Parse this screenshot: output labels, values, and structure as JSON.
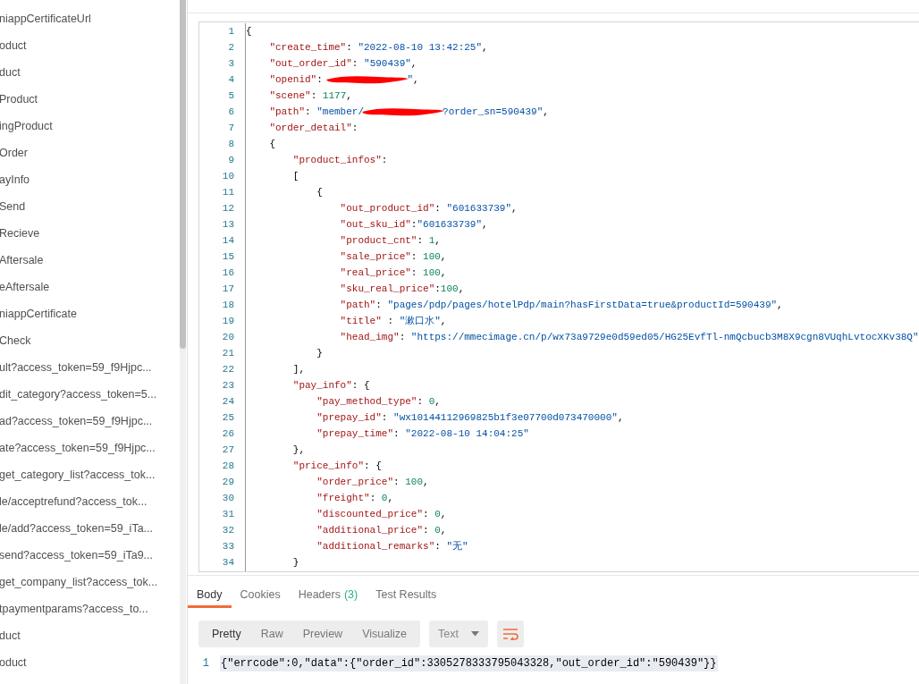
{
  "sidebar": {
    "items": [
      {
        "label": "niappCertificateUrl"
      },
      {
        "label": "oduct"
      },
      {
        "label": "duct"
      },
      {
        "label": "Product"
      },
      {
        "label": "ingProduct"
      },
      {
        "label": "Order"
      },
      {
        "label": "ayInfo"
      },
      {
        "label": "Send"
      },
      {
        "label": "Recieve"
      },
      {
        "label": "Aftersale"
      },
      {
        "label": "eAftersale"
      },
      {
        "label": "niappCertificate"
      },
      {
        "label": "Check"
      },
      {
        "label": "ult?access_token=59_f9Hjpc..."
      },
      {
        "label": "dit_category?access_token=5..."
      },
      {
        "label": "ad?access_token=59_f9Hjpc..."
      },
      {
        "label": "ate?access_token=59_f9Hjpc..."
      },
      {
        "label": "get_category_list?access_tok..."
      },
      {
        "label": "le/acceptrefund?access_tok..."
      },
      {
        "label": "le/add?access_token=59_iTa..."
      },
      {
        "label": "send?access_token=59_iTa9..."
      },
      {
        "label": "get_company_list?access_tok..."
      },
      {
        "label": "tpaymentparams?access_to..."
      },
      {
        "label": "duct"
      },
      {
        "label": "oduct"
      }
    ]
  },
  "editor": {
    "lines": [
      {
        "number": "1",
        "segments": [
          {
            "kind": "punct",
            "text": "{"
          }
        ]
      },
      {
        "number": "2",
        "segments": [
          {
            "kind": "key",
            "text": "    \"create_time\""
          },
          {
            "kind": "punct",
            "text": ": "
          },
          {
            "kind": "string",
            "text": "\"2022-08-10 13:42:25\""
          },
          {
            "kind": "punct",
            "text": ","
          }
        ]
      },
      {
        "number": "3",
        "segments": [
          {
            "kind": "key",
            "text": "    \"out_order_id\""
          },
          {
            "kind": "punct",
            "text": ": "
          },
          {
            "kind": "string",
            "text": "\"590439\""
          },
          {
            "kind": "punct",
            "text": ","
          }
        ]
      },
      {
        "number": "4",
        "segments": [
          {
            "kind": "key",
            "text": "    \"openid\""
          },
          {
            "kind": "punct",
            "text": ": "
          },
          {
            "kind": "redacted"
          },
          {
            "kind": "string",
            "text": "\""
          },
          {
            "kind": "punct",
            "text": ","
          }
        ]
      },
      {
        "number": "5",
        "segments": [
          {
            "kind": "key",
            "text": "    \"scene\""
          },
          {
            "kind": "punct",
            "text": ": "
          },
          {
            "kind": "number",
            "text": "1177"
          },
          {
            "kind": "punct",
            "text": ","
          }
        ]
      },
      {
        "number": "6",
        "segments": [
          {
            "kind": "key",
            "text": "    \"path\""
          },
          {
            "kind": "punct",
            "text": ": "
          },
          {
            "kind": "string",
            "text": "\"member/"
          },
          {
            "kind": "redacted"
          },
          {
            "kind": "string",
            "text": "?order_sn=590439\""
          },
          {
            "kind": "punct",
            "text": ","
          }
        ]
      },
      {
        "number": "7",
        "segments": [
          {
            "kind": "key",
            "text": "    \"order_detail\""
          },
          {
            "kind": "punct",
            "text": ":"
          }
        ]
      },
      {
        "number": "8",
        "segments": [
          {
            "kind": "punct",
            "text": "    {"
          }
        ]
      },
      {
        "number": "9",
        "segments": [
          {
            "kind": "key",
            "text": "        \"product_infos\""
          },
          {
            "kind": "punct",
            "text": ":"
          }
        ]
      },
      {
        "number": "10",
        "segments": [
          {
            "kind": "punct",
            "text": "        ["
          }
        ]
      },
      {
        "number": "11",
        "segments": [
          {
            "kind": "punct",
            "text": "            {"
          }
        ]
      },
      {
        "number": "12",
        "segments": [
          {
            "kind": "key",
            "text": "                \"out_product_id\""
          },
          {
            "kind": "punct",
            "text": ": "
          },
          {
            "kind": "string",
            "text": "\"601633739\""
          },
          {
            "kind": "punct",
            "text": ","
          }
        ]
      },
      {
        "number": "13",
        "segments": [
          {
            "kind": "key",
            "text": "                \"out_sku_id\""
          },
          {
            "kind": "punct",
            "text": ":"
          },
          {
            "kind": "string",
            "text": "\"601633739\""
          },
          {
            "kind": "punct",
            "text": ","
          }
        ]
      },
      {
        "number": "14",
        "segments": [
          {
            "kind": "key",
            "text": "                \"product_cnt\""
          },
          {
            "kind": "punct",
            "text": ": "
          },
          {
            "kind": "number",
            "text": "1"
          },
          {
            "kind": "punct",
            "text": ","
          }
        ]
      },
      {
        "number": "15",
        "segments": [
          {
            "kind": "key",
            "text": "                \"sale_price\""
          },
          {
            "kind": "punct",
            "text": ": "
          },
          {
            "kind": "number",
            "text": "100"
          },
          {
            "kind": "punct",
            "text": ","
          }
        ]
      },
      {
        "number": "16",
        "segments": [
          {
            "kind": "key",
            "text": "                \"real_price\""
          },
          {
            "kind": "punct",
            "text": ": "
          },
          {
            "kind": "number",
            "text": "100"
          },
          {
            "kind": "punct",
            "text": ","
          }
        ]
      },
      {
        "number": "17",
        "segments": [
          {
            "kind": "key",
            "text": "                \"sku_real_price\""
          },
          {
            "kind": "punct",
            "text": ":"
          },
          {
            "kind": "number",
            "text": "100"
          },
          {
            "kind": "punct",
            "text": ","
          }
        ]
      },
      {
        "number": "18",
        "segments": [
          {
            "kind": "key",
            "text": "                \"path\""
          },
          {
            "kind": "punct",
            "text": ": "
          },
          {
            "kind": "string",
            "text": "\"pages/pdp/pages/hotelPdp/main?hasFirstData=true&productId=590439\""
          },
          {
            "kind": "punct",
            "text": ","
          }
        ]
      },
      {
        "number": "19",
        "segments": [
          {
            "kind": "key",
            "text": "                \"title\""
          },
          {
            "kind": "punct",
            "text": " : "
          },
          {
            "kind": "string",
            "text": "\"漱口水\""
          },
          {
            "kind": "punct",
            "text": ","
          }
        ]
      },
      {
        "number": "20",
        "segments": [
          {
            "kind": "key",
            "text": "                \"head_img\""
          },
          {
            "kind": "punct",
            "text": ": "
          },
          {
            "kind": "string",
            "text": "\"https://mmecimage.cn/p/wx73a9729e0d59ed05/HG25EvfTl-nmQcbucb3M8X9cgn8VUqhLvtocXKv38Q\""
          }
        ]
      },
      {
        "number": "21",
        "segments": [
          {
            "kind": "punct",
            "text": "            }"
          }
        ]
      },
      {
        "number": "22",
        "segments": [
          {
            "kind": "punct",
            "text": "        ],"
          }
        ]
      },
      {
        "number": "23",
        "segments": [
          {
            "kind": "key",
            "text": "        \"pay_info\""
          },
          {
            "kind": "punct",
            "text": ": {"
          }
        ]
      },
      {
        "number": "24",
        "segments": [
          {
            "kind": "key",
            "text": "            \"pay_method_type\""
          },
          {
            "kind": "punct",
            "text": ": "
          },
          {
            "kind": "number",
            "text": "0"
          },
          {
            "kind": "punct",
            "text": ","
          }
        ]
      },
      {
        "number": "25",
        "segments": [
          {
            "kind": "key",
            "text": "            \"prepay_id\""
          },
          {
            "kind": "punct",
            "text": ": "
          },
          {
            "kind": "string",
            "text": "\"wx10144112969825b1f3e07700d073470000\""
          },
          {
            "kind": "punct",
            "text": ","
          }
        ]
      },
      {
        "number": "26",
        "segments": [
          {
            "kind": "key",
            "text": "            \"prepay_time\""
          },
          {
            "kind": "punct",
            "text": ": "
          },
          {
            "kind": "string",
            "text": "\"2022-08-10 14:04:25\""
          }
        ]
      },
      {
        "number": "27",
        "segments": [
          {
            "kind": "punct",
            "text": "        },"
          }
        ]
      },
      {
        "number": "28",
        "segments": [
          {
            "kind": "key",
            "text": "        \"price_info\""
          },
          {
            "kind": "punct",
            "text": ": {"
          }
        ]
      },
      {
        "number": "29",
        "segments": [
          {
            "kind": "key",
            "text": "            \"order_price\""
          },
          {
            "kind": "punct",
            "text": ": "
          },
          {
            "kind": "number",
            "text": "100"
          },
          {
            "kind": "punct",
            "text": ","
          }
        ]
      },
      {
        "number": "30",
        "segments": [
          {
            "kind": "key",
            "text": "            \"freight\""
          },
          {
            "kind": "punct",
            "text": ": "
          },
          {
            "kind": "number",
            "text": "0"
          },
          {
            "kind": "punct",
            "text": ","
          }
        ]
      },
      {
        "number": "31",
        "segments": [
          {
            "kind": "key",
            "text": "            \"discounted_price\""
          },
          {
            "kind": "punct",
            "text": ": "
          },
          {
            "kind": "number",
            "text": "0"
          },
          {
            "kind": "punct",
            "text": ","
          }
        ]
      },
      {
        "number": "32",
        "segments": [
          {
            "kind": "key",
            "text": "            \"additional_price\""
          },
          {
            "kind": "punct",
            "text": ": "
          },
          {
            "kind": "number",
            "text": "0"
          },
          {
            "kind": "punct",
            "text": ","
          }
        ]
      },
      {
        "number": "33",
        "segments": [
          {
            "kind": "key",
            "text": "            \"additional_remarks\""
          },
          {
            "kind": "punct",
            "text": ": "
          },
          {
            "kind": "string",
            "text": "\"无\""
          }
        ]
      },
      {
        "number": "34",
        "segments": [
          {
            "kind": "punct",
            "text": "        }"
          }
        ]
      }
    ]
  },
  "response": {
    "tabs": [
      {
        "label": "Body",
        "selected": true
      },
      {
        "label": "Cookies",
        "selected": false
      },
      {
        "label": "Headers",
        "count": "(3)",
        "selected": false
      },
      {
        "label": "Test Results",
        "selected": false
      }
    ],
    "view_modes": [
      {
        "label": "Pretty",
        "selected": true
      },
      {
        "label": "Raw",
        "selected": false
      },
      {
        "label": "Preview",
        "selected": false
      },
      {
        "label": "Visualize",
        "selected": false
      }
    ],
    "format": "Text",
    "wrap_on": true,
    "lines": [
      {
        "number": "1",
        "text": "{\"errcode\":0,\"data\":{\"order_id\":3305278333795043328,\"out_order_id\":\"590439\"}}"
      }
    ]
  }
}
